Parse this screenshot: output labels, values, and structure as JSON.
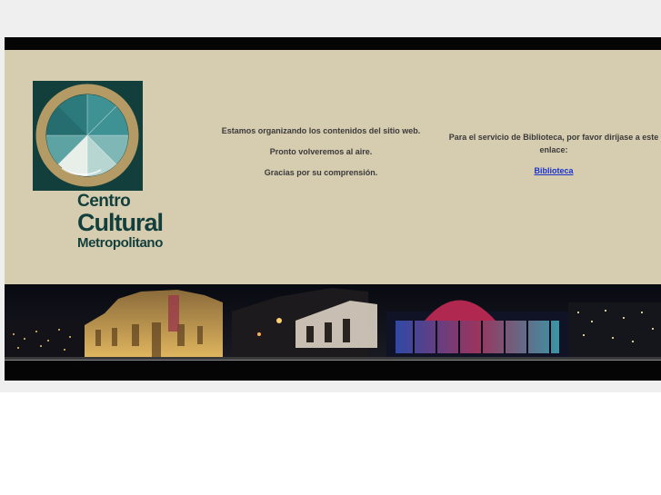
{
  "colors": {
    "beige": "#d6ccb0",
    "teal": "#123f3c",
    "link": "#1a33cc",
    "gold": "#b49b66"
  },
  "logo": {
    "icon": "sun-circle-logo-icon",
    "line1": "Centro",
    "line2": "Cultural",
    "line3": "Metropolitano"
  },
  "message": {
    "line1": "Estamos organizando los contenidos del sitio web.",
    "line2": "Pronto volveremos al aire.",
    "line3": "Gracias por su comprensión."
  },
  "library": {
    "text": "Para el servicio de Biblioteca, por favor diríjase a este enlace:",
    "link_label": "Biblioteca"
  },
  "banner": {
    "icon": "night-city-photo"
  }
}
